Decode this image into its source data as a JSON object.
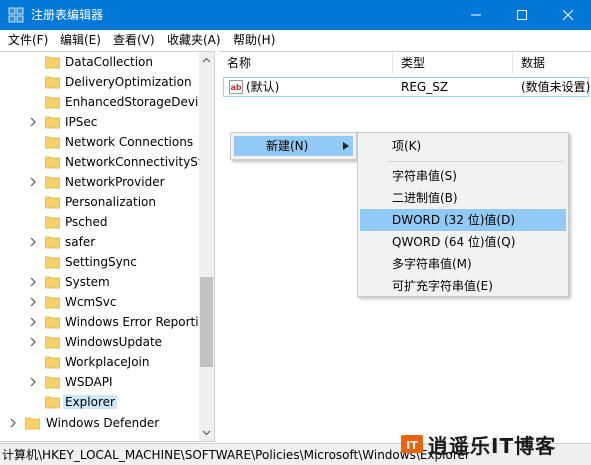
{
  "window": {
    "title": "注册表编辑器",
    "accent": "#0078d7"
  },
  "menubar": {
    "items": [
      "文件(F)",
      "编辑(E)",
      "查看(V)",
      "收藏夹(A)",
      "帮助(H)"
    ]
  },
  "tree": {
    "items": [
      {
        "label": "DataCollection",
        "has_children": false
      },
      {
        "label": "DeliveryOptimization",
        "has_children": false
      },
      {
        "label": "EnhancedStorageDevic",
        "has_children": false
      },
      {
        "label": "IPSec",
        "has_children": true
      },
      {
        "label": "Network Connections",
        "has_children": false
      },
      {
        "label": "NetworkConnectivitySta",
        "has_children": false
      },
      {
        "label": "NetworkProvider",
        "has_children": true
      },
      {
        "label": "Personalization",
        "has_children": false
      },
      {
        "label": "Psched",
        "has_children": false
      },
      {
        "label": "safer",
        "has_children": true
      },
      {
        "label": "SettingSync",
        "has_children": false
      },
      {
        "label": "System",
        "has_children": true
      },
      {
        "label": "WcmSvc",
        "has_children": true
      },
      {
        "label": "Windows Error Reporti",
        "has_children": true
      },
      {
        "label": "WindowsUpdate",
        "has_children": true
      },
      {
        "label": "WorkplaceJoin",
        "has_children": false
      },
      {
        "label": "WSDAPI",
        "has_children": true
      },
      {
        "label": "Explorer",
        "has_children": false,
        "selected": true
      }
    ],
    "parent_item": "Windows Defender"
  },
  "list": {
    "columns": [
      "名称",
      "类型",
      "数据"
    ],
    "rows": [
      {
        "name": "(默认)",
        "type": "REG_SZ",
        "data": "(数值未设置)",
        "icon": "string-value-icon"
      }
    ]
  },
  "context_menu": {
    "new_label": "新建(N)"
  },
  "submenu": {
    "items": [
      {
        "label": "项(K)",
        "highlighted": false
      },
      {
        "label": "字符串值(S)",
        "highlighted": false
      },
      {
        "label": "二进制值(B)",
        "highlighted": false
      },
      {
        "label": "DWORD (32 位)值(D)",
        "highlighted": true
      },
      {
        "label": "QWORD (64 位)值(Q)",
        "highlighted": false
      },
      {
        "label": "多字符串值(M)",
        "highlighted": false
      },
      {
        "label": "可扩充字符串值(E)",
        "highlighted": false
      }
    ],
    "highlight_color": "#91c9f7"
  },
  "statusbar": {
    "path": "计算机\\HKEY_LOCAL_MACHINE\\SOFTWARE\\Policies\\Microsoft\\Windows\\Explorer"
  },
  "watermark": {
    "text": "逍遥乐IT博客"
  }
}
